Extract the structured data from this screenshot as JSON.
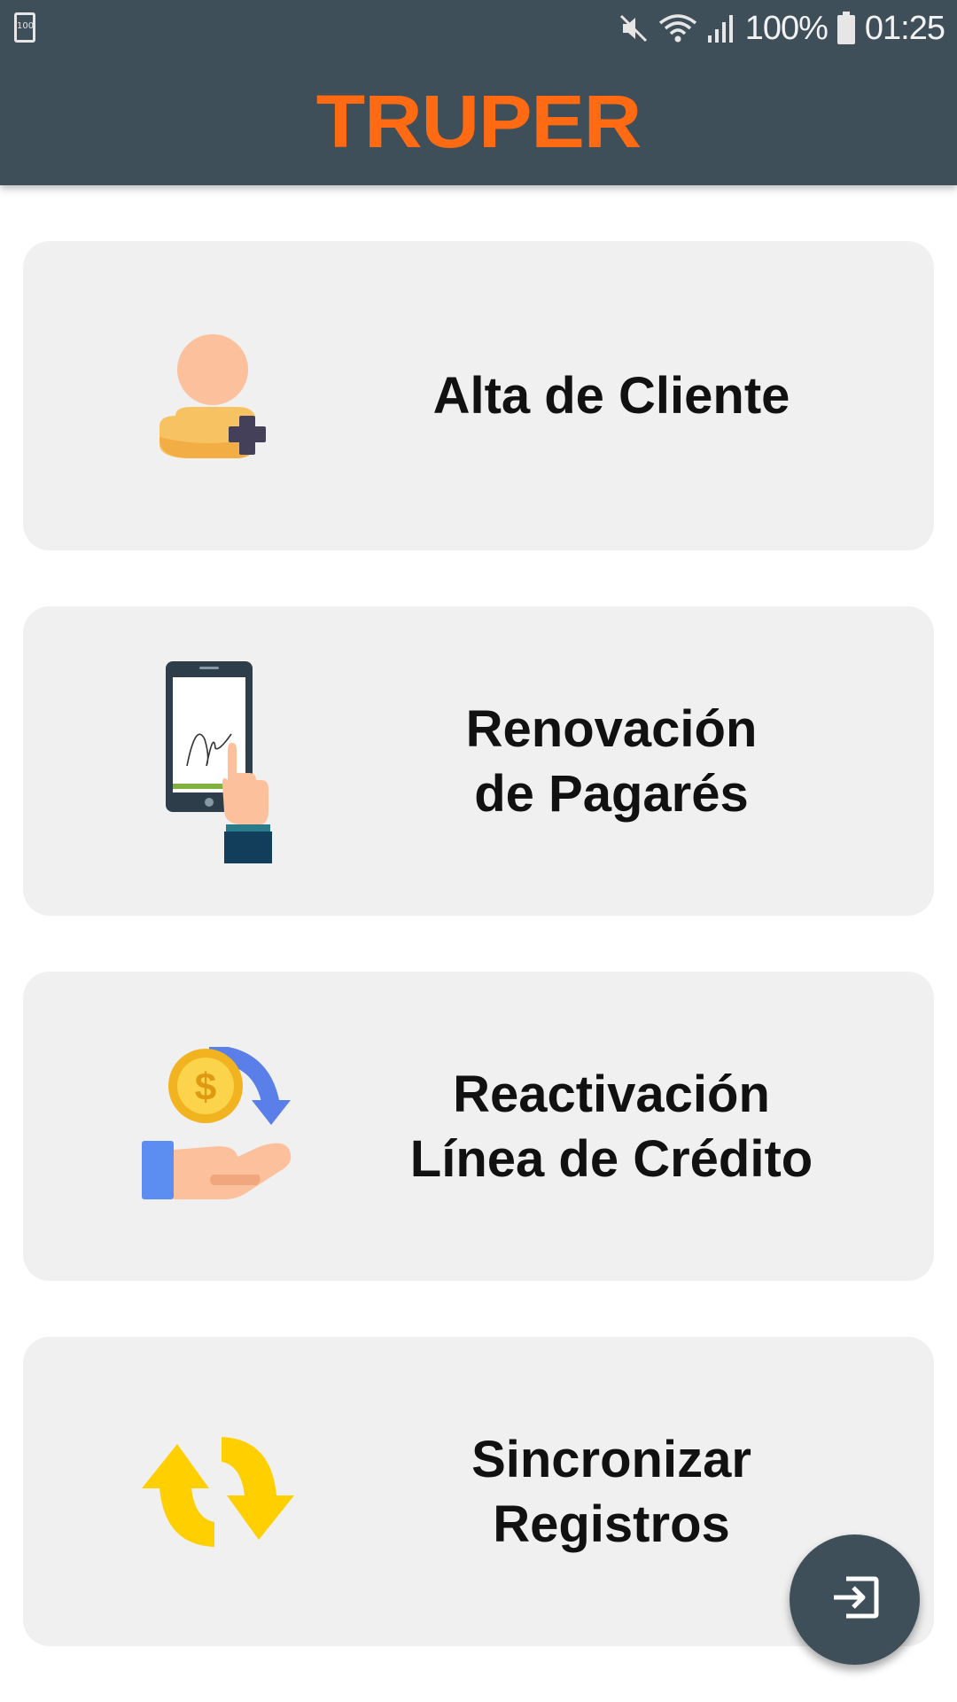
{
  "status_bar": {
    "battery_small_label": "100",
    "battery_percent": "100%",
    "time": "01:25",
    "icons": [
      "mute-icon",
      "wifi-icon",
      "signal-icon",
      "battery-icon"
    ]
  },
  "header": {
    "brand": "TRUPER",
    "background_color": "#3f4f5a",
    "brand_color": "#ff6a13"
  },
  "menu": {
    "items": [
      {
        "label": "Alta de Cliente",
        "icon": "add-user-icon"
      },
      {
        "label": "Renovación\nde Pagarés",
        "icon": "tablet-signature-icon"
      },
      {
        "label": "Reactivación\nLínea de Crédito",
        "icon": "coin-hand-icon"
      },
      {
        "label": "Sincronizar\nRegistros",
        "icon": "sync-arrows-icon"
      }
    ]
  },
  "fab": {
    "icon": "logout-icon"
  }
}
